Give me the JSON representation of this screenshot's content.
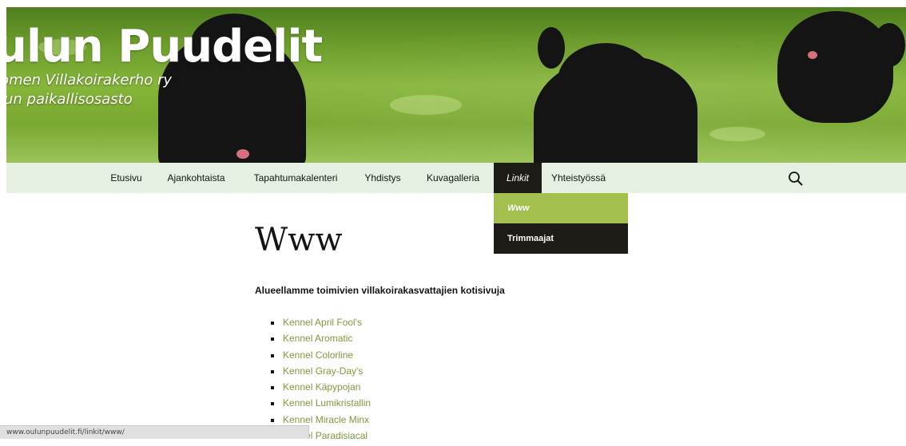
{
  "site": {
    "title": "ulun Puudelit",
    "description_line1": "omen Villakoirakerho ry",
    "description_line2": "lun paikallisosasto"
  },
  "nav": {
    "items": [
      {
        "label": "Etusivu"
      },
      {
        "label": "Ajankohtaista"
      },
      {
        "label": "Tapahtumakalenteri"
      },
      {
        "label": "Yhdistys"
      },
      {
        "label": "Kuvagalleria"
      },
      {
        "label": "Linkit",
        "active": true
      },
      {
        "label": "Yhteistyössä"
      }
    ],
    "search_icon": "search-icon",
    "submenu": [
      {
        "label": "Www",
        "current": true
      },
      {
        "label": "Trimmaajat"
      }
    ]
  },
  "content": {
    "title": "Www",
    "intro": "Alueellamme toimivien villakoirakasvattajien kotisivuja",
    "links": [
      "Kennel April Fool's",
      "Kennel Aromatic",
      "Kennel Colorline",
      "Kennel Gray-Day's",
      "Kennel Käpypojan",
      "Kennel Lumikristallin",
      "Kennel Miracle Minx",
      "Kennel Paradisiacal"
    ]
  },
  "status_bar": {
    "url": "www.oulunpuudelit.fi/linkit/www/"
  },
  "colors": {
    "nav_background": "#e5efe2",
    "active_nav": "#1e1c16",
    "submenu_current": "#a3bf4d",
    "link": "#7e9a3b"
  }
}
